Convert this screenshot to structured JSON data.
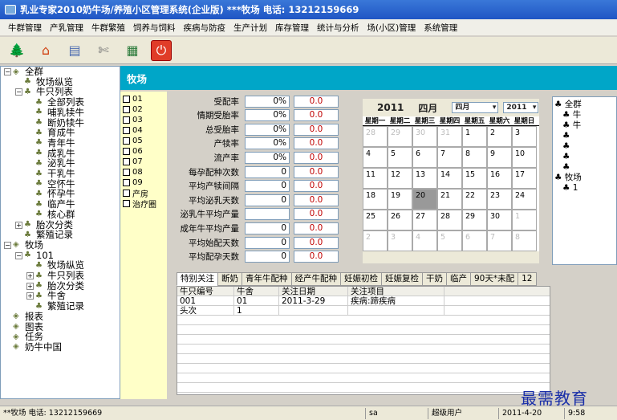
{
  "window": {
    "title": "乳业专家2010奶牛场/养殖小区管理系统(企业版)   ***牧场  电话: 13212159669"
  },
  "menu": [
    "牛群管理",
    "产乳管理",
    "牛群繁殖",
    "饲养与饲料",
    "疾病与防疫",
    "生产计划",
    "库存管理",
    "统计与分析",
    "场(小区)管理",
    "系统管理"
  ],
  "tree": [
    {
      "label": "全群",
      "level": 0,
      "toggle": "−"
    },
    {
      "label": "牧场纵览",
      "level": 1,
      "toggle": ""
    },
    {
      "label": "牛只列表",
      "level": 1,
      "toggle": "−"
    },
    {
      "label": "全部列表",
      "level": 2,
      "toggle": ""
    },
    {
      "label": "哺乳犊牛",
      "level": 2,
      "toggle": ""
    },
    {
      "label": "断奶犊牛",
      "level": 2,
      "toggle": ""
    },
    {
      "label": "育成牛",
      "level": 2,
      "toggle": ""
    },
    {
      "label": "青年牛",
      "level": 2,
      "toggle": ""
    },
    {
      "label": "成乳牛",
      "level": 2,
      "toggle": ""
    },
    {
      "label": "泌乳牛",
      "level": 2,
      "toggle": ""
    },
    {
      "label": "干乳牛",
      "level": 2,
      "toggle": ""
    },
    {
      "label": "空怀牛",
      "level": 2,
      "toggle": ""
    },
    {
      "label": "怀孕牛",
      "level": 2,
      "toggle": ""
    },
    {
      "label": "临产牛",
      "level": 2,
      "toggle": ""
    },
    {
      "label": "核心群",
      "level": 2,
      "toggle": ""
    },
    {
      "label": "胎次分类",
      "level": 1,
      "toggle": "+"
    },
    {
      "label": "繁殖记录",
      "level": 1,
      "toggle": ""
    },
    {
      "label": "牧场",
      "level": 0,
      "toggle": "−"
    },
    {
      "label": "101",
      "level": 1,
      "toggle": "−"
    },
    {
      "label": "牧场纵览",
      "level": 2,
      "toggle": ""
    },
    {
      "label": "牛只列表",
      "level": 2,
      "toggle": "+"
    },
    {
      "label": "胎次分类",
      "level": 2,
      "toggle": "+"
    },
    {
      "label": "牛舍",
      "level": 2,
      "toggle": "+"
    },
    {
      "label": "繁殖记录",
      "level": 2,
      "toggle": ""
    },
    {
      "label": "报表",
      "level": 0,
      "toggle": ""
    },
    {
      "label": "图表",
      "level": 0,
      "toggle": ""
    },
    {
      "label": "任务",
      "level": 0,
      "toggle": ""
    },
    {
      "label": "奶牛中国",
      "level": 0,
      "toggle": ""
    }
  ],
  "header": {
    "title": "牧场"
  },
  "rooms": [
    "01",
    "02",
    "03",
    "04",
    "05",
    "06",
    "07",
    "08",
    "09",
    "产房",
    "治疗圈"
  ],
  "stats": [
    {
      "label": "受配率",
      "v1": "0%",
      "v2": "0.0"
    },
    {
      "label": "情期受胎率",
      "v1": "0%",
      "v2": "0.0"
    },
    {
      "label": "总受胎率",
      "v1": "0%",
      "v2": "0.0"
    },
    {
      "label": "产犊率",
      "v1": "0%",
      "v2": "0.0"
    },
    {
      "label": "流产率",
      "v1": "0%",
      "v2": "0.0"
    },
    {
      "label": "每孕配种次数",
      "v1": "0",
      "v2": "0.0"
    },
    {
      "label": "平均产犊间隔",
      "v1": "0",
      "v2": "0.0"
    },
    {
      "label": "平均泌乳天数",
      "v1": "0",
      "v2": "0.0"
    },
    {
      "label": "泌乳牛平均产量",
      "v1": "",
      "v2": "0.0"
    },
    {
      "label": "成年牛平均产量",
      "v1": "0",
      "v2": "0.0"
    },
    {
      "label": "平均始配天数",
      "v1": "0",
      "v2": "0.0"
    },
    {
      "label": "平均配孕天数",
      "v1": "0",
      "v2": "0.0"
    }
  ],
  "calendar": {
    "year": "2011",
    "month": "四月",
    "month_select": "四月",
    "year_select": "2011",
    "weekdays": [
      "星期一",
      "星期二",
      "星期三",
      "星期四",
      "星期五",
      "星期六",
      "星期日"
    ],
    "days": [
      {
        "d": "28",
        "other": true
      },
      {
        "d": "29",
        "other": true
      },
      {
        "d": "30",
        "other": true
      },
      {
        "d": "31",
        "other": true
      },
      {
        "d": "1",
        "other": false
      },
      {
        "d": "2",
        "other": false
      },
      {
        "d": "3",
        "other": false
      },
      {
        "d": "4",
        "other": false
      },
      {
        "d": "5",
        "other": false
      },
      {
        "d": "6",
        "other": false
      },
      {
        "d": "7",
        "other": false
      },
      {
        "d": "8",
        "other": false
      },
      {
        "d": "9",
        "other": false
      },
      {
        "d": "10",
        "other": false
      },
      {
        "d": "11",
        "other": false
      },
      {
        "d": "12",
        "other": false
      },
      {
        "d": "13",
        "other": false
      },
      {
        "d": "14",
        "other": false
      },
      {
        "d": "15",
        "other": false
      },
      {
        "d": "16",
        "other": false
      },
      {
        "d": "17",
        "other": false
      },
      {
        "d": "18",
        "other": false
      },
      {
        "d": "19",
        "other": false
      },
      {
        "d": "20",
        "other": false,
        "selected": true
      },
      {
        "d": "21",
        "other": false
      },
      {
        "d": "22",
        "other": false
      },
      {
        "d": "23",
        "other": false
      },
      {
        "d": "24",
        "other": false
      },
      {
        "d": "25",
        "other": false
      },
      {
        "d": "26",
        "other": false
      },
      {
        "d": "27",
        "other": false
      },
      {
        "d": "28",
        "other": false
      },
      {
        "d": "29",
        "other": false
      },
      {
        "d": "30",
        "other": false
      },
      {
        "d": "1",
        "other": true
      },
      {
        "d": "2",
        "other": true
      },
      {
        "d": "3",
        "other": true
      },
      {
        "d": "4",
        "other": true
      },
      {
        "d": "5",
        "other": true
      },
      {
        "d": "6",
        "other": true
      },
      {
        "d": "7",
        "other": true
      },
      {
        "d": "8",
        "other": true
      }
    ]
  },
  "right_tree": [
    "全群",
    "牛",
    "牛",
    "",
    "",
    "",
    "",
    "牧场",
    "1"
  ],
  "tabs": [
    "特别关注",
    "断奶",
    "青年牛配种",
    "经产牛配种",
    "妊娠初检",
    "妊娠复检",
    "干奶",
    "临产",
    "90天*未配",
    "12"
  ],
  "table": {
    "headers": [
      "牛只编号",
      "牛舍",
      "关注日期",
      "关注项目"
    ],
    "rows": [
      [
        "001",
        "01",
        "2011-3-29",
        "疾病:蹄疾病"
      ],
      [
        "头次",
        "1",
        "",
        ""
      ]
    ]
  },
  "status": {
    "farm": "**牧场 电话: 13212159669",
    "user_id": "sa",
    "role": "超级用户",
    "date": "2011-4-20",
    "time": "9:58"
  },
  "watermark": "最需教育",
  "colors": {
    "header_bg": "#00a6c8",
    "rooms_bg": "#ffffc8",
    "value_red": "#c00000",
    "title_bar": "#1f55c4"
  }
}
